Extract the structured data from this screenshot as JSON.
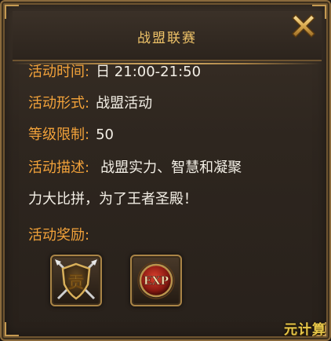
{
  "window": {
    "title": "战盟联赛"
  },
  "details": {
    "time": {
      "label": "活动时间",
      "colon": ":",
      "value": "日 21:00-21:50"
    },
    "form": {
      "label": "活动形式",
      "colon": ":",
      "value": "战盟活动"
    },
    "level": {
      "label": "等级限制",
      "colon": ":",
      "value": "50"
    },
    "desc": {
      "label": "活动描述",
      "colon": ":",
      "value_line1": "战盟实力、智慧和凝聚",
      "value_line2": "力大比拼，为了王者圣殿！"
    },
    "rewards": {
      "label": "活动奖励",
      "colon": ":"
    }
  },
  "rewards": [
    {
      "icon": "contribution-icon",
      "glyph": "贡"
    },
    {
      "icon": "exp-icon",
      "glyph": "EXP"
    }
  ],
  "watermark": "元计算",
  "colors": {
    "label": "#f2a23a",
    "value": "#f3efe6",
    "title": "#f0c469",
    "frame": "#8a6a3c"
  }
}
